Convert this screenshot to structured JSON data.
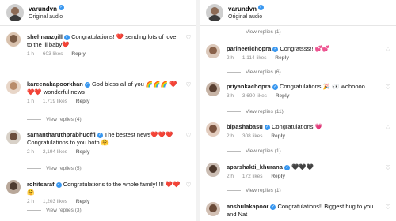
{
  "left": {
    "header": {
      "username": "varundvn",
      "audio": "Original audio"
    },
    "comments": [
      {
        "user": "shehnaazgill",
        "text": "Congratulations! ❤️ sending lots of love to the lil baby❤️",
        "age": "1 h",
        "likes": "603 likes",
        "reply": "Reply"
      },
      {
        "user": "kareenakapoorkhan",
        "text": "God bless all of you 🌈🌈🌈 ❤️❤️❤️ wonderful news",
        "age": "1 h",
        "likes": "1,719 likes",
        "reply": "Reply",
        "view_replies": "View replies (4)"
      },
      {
        "user": "samantharuthprabhuoffl",
        "text": "The bestest news❤️❤️❤️ Congratulations to you both 🤗",
        "age": "2 h",
        "likes": "2,194 likes",
        "reply": "Reply",
        "view_replies": "View replies (5)"
      },
      {
        "user": "rohitsaraf",
        "text": "Congratulations to the whole family!!!!! ❤️❤️🤗",
        "age": "2 h",
        "likes": "1,203 likes",
        "reply": "Reply",
        "view_replies": "View replies (3)"
      }
    ]
  },
  "right": {
    "header": {
      "username": "varundvn",
      "audio": "Original audio"
    },
    "top_view_replies": "View replies (1)",
    "comments": [
      {
        "user": "parineetichopra",
        "text": "Congratsss!! 💕💕",
        "age": "2 h",
        "likes": "1,114 likes",
        "reply": "Reply",
        "view_replies": "View replies (6)"
      },
      {
        "user": "priyankachopra",
        "text": "Congratulations 🎉 👀 wohoooo",
        "age": "3 h",
        "likes": "3,690 likes",
        "reply": "Reply",
        "view_replies": "View replies (11)"
      },
      {
        "user": "bipashabasu",
        "text": "Congratulations 💗",
        "age": "2 h",
        "likes": "308 likes",
        "reply": "Reply",
        "view_replies": "View replies (1)"
      },
      {
        "user": "aparshakti_khurana",
        "text": "🖤🖤🖤",
        "age": "2 h",
        "likes": "172 likes",
        "reply": "Reply",
        "view_replies": "View replies (1)"
      },
      {
        "user": "anshulakapoor",
        "text": "Congratulations!! Biggest hug to you and Nat",
        "age": "",
        "likes": "",
        "reply": ""
      }
    ]
  },
  "colors": {
    "verified": "#3897f0",
    "meta": "#8e8e8e",
    "like_icon": "#999999"
  },
  "icons": [
    "heart-outline-icon",
    "verified-badge-icon"
  ]
}
